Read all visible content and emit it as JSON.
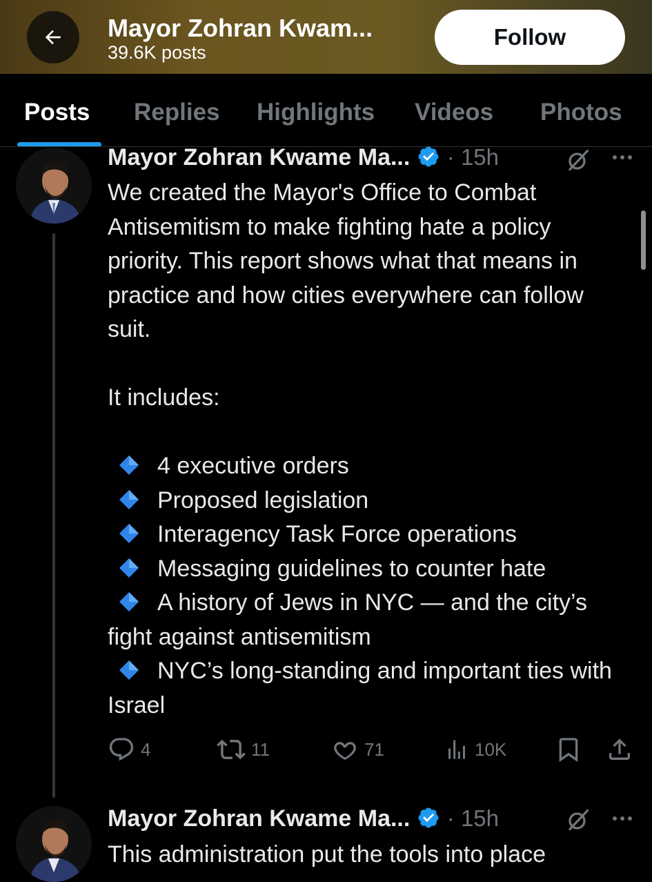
{
  "header": {
    "title": "Mayor Zohran Kwam...",
    "post_count": "39.6K posts",
    "follow_label": "Follow",
    "back_icon": "arrow-left-icon"
  },
  "tabs": [
    {
      "label": "Posts",
      "active": true
    },
    {
      "label": "Replies",
      "active": false
    },
    {
      "label": "Highlights",
      "active": false
    },
    {
      "label": "Videos",
      "active": false
    },
    {
      "label": "Photos",
      "active": false
    }
  ],
  "posts": [
    {
      "author": "Mayor Zohran Kwame Ma...",
      "verified": true,
      "time": "· 15h",
      "paragraphs": [
        "We created the Mayor's Office to Combat Antisemitism to make fighting hate a policy priority. This report shows what that means in practice and how cities everywhere can follow suit.",
        "It includes:"
      ],
      "bullets": [
        "4 executive orders",
        "Proposed legislation",
        "Interagency Task Force operations",
        "Messaging guidelines to counter hate",
        "A history of Jews in NYC — and the city’s fight against antisemitism",
        "NYC’s long-standing and important ties with Israel"
      ],
      "bullet_icon": "small-blue-diamond-icon",
      "actions": {
        "replies": "4",
        "reposts": "11",
        "likes": "71",
        "views": "10K"
      }
    },
    {
      "author": "Mayor Zohran Kwame Ma...",
      "verified": true,
      "time": "· 15h",
      "text": "This administration put the tools into place"
    }
  ],
  "colors": {
    "accent": "#1d9bf0",
    "muted": "#71767b",
    "text": "#e7e9ea",
    "background": "#000000"
  }
}
